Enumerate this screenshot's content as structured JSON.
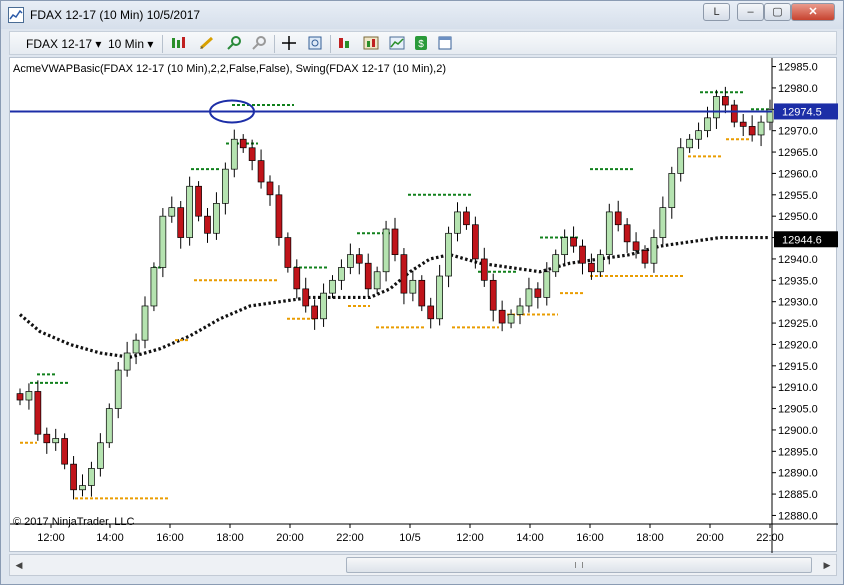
{
  "window": {
    "title": "FDAX 12-17 (10 Min)  10/5/2017",
    "buttons": [
      "L",
      "–",
      "▢",
      "✕"
    ]
  },
  "toolbar": {
    "instrument": "FDAX 12-17",
    "interval": "10 Min",
    "dropdown_arrow": "▾"
  },
  "chart": {
    "indicator_label": "AcmeVWAPBasic(FDAX 12-17 (10 Min),2,2,False,False), Swing(FDAX 12-17 (10 Min),2)",
    "copyright": "© 2017 NinjaTrader, LLC",
    "colors": {
      "up_candle": "#b5e3b0",
      "down_candle": "#c0141a",
      "swing_high": "#11801c",
      "swing_low": "#e99c00",
      "vwap": "#111111",
      "hline": "#1c2ea7",
      "price_badge": "#1c2ea7",
      "vwap_badge": "#000000"
    }
  },
  "chart_data": {
    "type": "candlestick",
    "ylim": [
      12878,
      12987
    ],
    "y_ticks": [
      "12985.0",
      "12980.0",
      "12975.0",
      "12970.0",
      "12965.0",
      "12960.0",
      "12955.0",
      "12950.0",
      "12945.0",
      "12940.0",
      "12935.0",
      "12930.0",
      "12925.0",
      "12920.0",
      "12915.0",
      "12910.0",
      "12905.0",
      "12900.0",
      "12895.0",
      "12890.0",
      "12885.0",
      "12880.0"
    ],
    "x_ticks": [
      "12:00",
      "14:00",
      "16:00",
      "18:00",
      "20:00",
      "22:00",
      "10/5",
      "12:00",
      "14:00",
      "16:00",
      "18:00",
      "20:00",
      "22:00"
    ],
    "close_path": [
      12907,
      12909,
      12899,
      12897,
      12898,
      12892,
      12886,
      12887,
      12891,
      12897,
      12905,
      12914,
      12918,
      12921,
      12929,
      12938,
      12950,
      12952,
      12945,
      12957,
      12950,
      12946,
      12953,
      12961,
      12968,
      12966,
      12963,
      12958,
      12955,
      12945,
      12938,
      12933,
      12929,
      12926,
      12932,
      12935,
      12938,
      12941,
      12939,
      12933,
      12937,
      12947,
      12941,
      12932,
      12935,
      12929,
      12926,
      12936,
      12946,
      12951,
      12948,
      12940,
      12935,
      12928,
      12925,
      12927,
      12929,
      12933,
      12931,
      12937,
      12941,
      12945,
      12943,
      12939,
      12937,
      12941,
      12951,
      12948,
      12944,
      12942,
      12939,
      12945,
      12952,
      12960,
      12966,
      12968,
      12970,
      12973,
      12978,
      12976,
      12972,
      12971,
      12969,
      12972,
      12975
    ],
    "swing_highs": [
      {
        "y": 12911,
        "start": 20,
        "end": 58
      },
      {
        "y": 12913,
        "start": 27,
        "end": 45
      },
      {
        "y": 12938,
        "start": 143,
        "end": 153
      },
      {
        "y": 12961,
        "start": 181,
        "end": 211
      },
      {
        "y": 12967,
        "start": 216,
        "end": 248
      },
      {
        "y": 12938,
        "start": 284,
        "end": 318
      },
      {
        "y": 12946,
        "start": 347,
        "end": 385
      },
      {
        "y": 12955,
        "start": 398,
        "end": 462
      },
      {
        "y": 12937,
        "start": 468,
        "end": 508
      },
      {
        "y": 12945,
        "start": 530,
        "end": 570
      },
      {
        "y": 12961,
        "start": 580,
        "end": 624
      },
      {
        "y": 12979,
        "start": 690,
        "end": 734
      },
      {
        "y": 12975,
        "start": 741,
        "end": 761
      },
      {
        "y": 12976,
        "start": 222,
        "end": 284
      }
    ],
    "swing_lows": [
      {
        "y": 12897,
        "start": 10,
        "end": 27
      },
      {
        "y": 12884,
        "start": 65,
        "end": 160
      },
      {
        "y": 12921,
        "start": 165,
        "end": 180
      },
      {
        "y": 12935,
        "start": 184,
        "end": 267
      },
      {
        "y": 12926,
        "start": 277,
        "end": 305
      },
      {
        "y": 12929,
        "start": 338,
        "end": 360
      },
      {
        "y": 12924,
        "start": 366,
        "end": 414
      },
      {
        "y": 12924,
        "start": 442,
        "end": 489
      },
      {
        "y": 12927,
        "start": 492,
        "end": 548
      },
      {
        "y": 12932,
        "start": 550,
        "end": 573
      },
      {
        "y": 12936,
        "start": 580,
        "end": 674
      },
      {
        "y": 12964,
        "start": 678,
        "end": 712
      },
      {
        "y": 12968,
        "start": 716,
        "end": 741
      }
    ],
    "vwap_points": [
      [
        10,
        12927
      ],
      [
        30,
        12923
      ],
      [
        60,
        12920
      ],
      [
        90,
        12918
      ],
      [
        120,
        12917
      ],
      [
        150,
        12919
      ],
      [
        180,
        12922
      ],
      [
        210,
        12926
      ],
      [
        240,
        12929
      ],
      [
        270,
        12930
      ],
      [
        300,
        12931
      ],
      [
        330,
        12931
      ],
      [
        360,
        12931
      ],
      [
        380,
        12933
      ],
      [
        400,
        12937
      ],
      [
        420,
        12940
      ],
      [
        440,
        12941
      ],
      [
        470,
        12939
      ],
      [
        500,
        12938
      ],
      [
        530,
        12937
      ],
      [
        560,
        12939
      ],
      [
        590,
        12940
      ],
      [
        620,
        12941
      ],
      [
        650,
        12943
      ],
      [
        680,
        12944
      ],
      [
        710,
        12945
      ],
      [
        740,
        12945
      ],
      [
        760,
        12945
      ]
    ],
    "hline_price": 12974.5,
    "price_label": "12974.5",
    "vwap_label": "12944.6",
    "ellipse_center": {
      "x": 222,
      "y": 12974.5
    }
  }
}
